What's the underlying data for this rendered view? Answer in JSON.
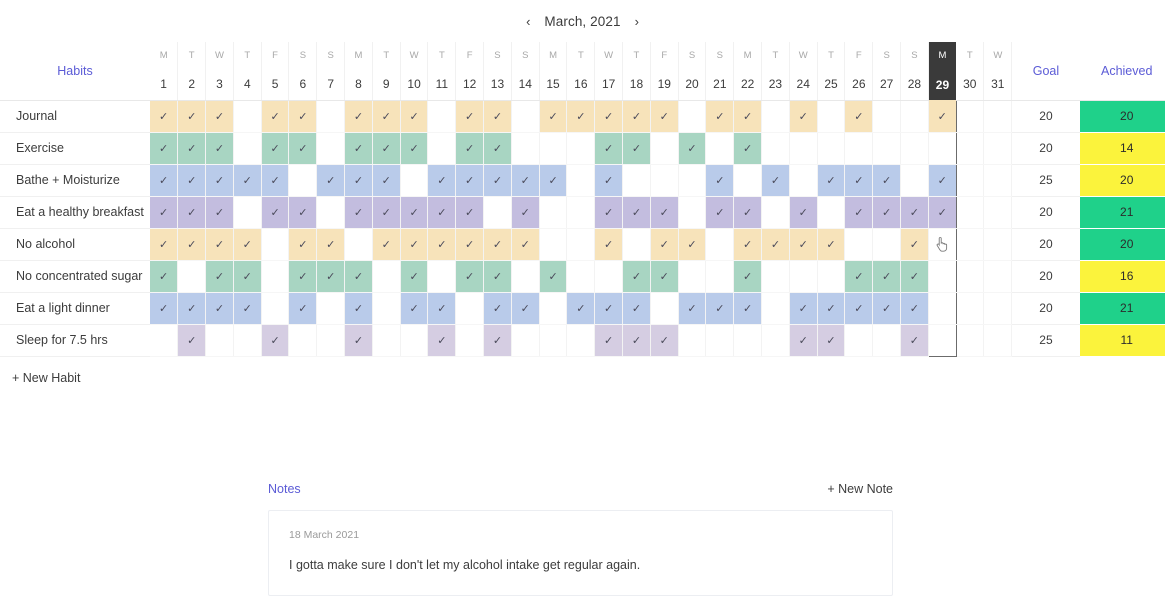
{
  "month_nav": {
    "prev_icon": "chevron-left-icon",
    "prev_label": "‹",
    "label": "March, 2021",
    "next_icon": "chevron-right-icon",
    "next_label": "›"
  },
  "tracker": {
    "habits_header": "Habits",
    "goal_header": "Goal",
    "achieved_header": "Achieved",
    "new_habit_label": "+ New Habit",
    "today": 29,
    "days": [
      1,
      2,
      3,
      4,
      5,
      6,
      7,
      8,
      9,
      10,
      11,
      12,
      13,
      14,
      15,
      16,
      17,
      18,
      19,
      20,
      21,
      22,
      23,
      24,
      25,
      26,
      27,
      28,
      29,
      30,
      31
    ],
    "dow": [
      "M",
      "T",
      "W",
      "T",
      "F",
      "S",
      "S",
      "M",
      "T",
      "W",
      "T",
      "F",
      "S",
      "S",
      "M",
      "T",
      "W",
      "T",
      "F",
      "S",
      "S",
      "M",
      "T",
      "W",
      "T",
      "F",
      "S",
      "S",
      "M",
      "T",
      "W"
    ],
    "check_glyph": "✓",
    "colors": {
      "peach": "#f7e3ba",
      "green": "#a8d5c2",
      "blue": "#b9cbea",
      "purple": "#c3bddf",
      "lilac": "#d5cde2",
      "achieved_met": "#1fd18a",
      "achieved_miss": "#fbf33c",
      "today_header_bg": "#3a3a3a",
      "accent": "#5b5bd6"
    },
    "rows": [
      {
        "name": "Journal",
        "color": "peach",
        "goal": 20,
        "achieved": 20,
        "met": true,
        "checks": [
          1,
          2,
          3,
          5,
          6,
          8,
          9,
          10,
          12,
          13,
          15,
          16,
          17,
          18,
          19,
          21,
          22,
          24,
          26,
          29
        ]
      },
      {
        "name": "Exercise",
        "color": "green",
        "goal": 20,
        "achieved": 14,
        "met": false,
        "checks": [
          1,
          2,
          3,
          5,
          6,
          8,
          9,
          10,
          12,
          13,
          17,
          18,
          20,
          22
        ]
      },
      {
        "name": "Bathe + Moisturize",
        "color": "blue",
        "goal": 25,
        "achieved": 20,
        "met": false,
        "checks": [
          1,
          2,
          3,
          4,
          5,
          7,
          8,
          9,
          11,
          12,
          13,
          14,
          15,
          17,
          21,
          23,
          25,
          26,
          27,
          29
        ]
      },
      {
        "name": "Eat a healthy breakfast",
        "color": "purple",
        "goal": 20,
        "achieved": 21,
        "met": true,
        "checks": [
          1,
          2,
          3,
          5,
          6,
          8,
          9,
          10,
          11,
          12,
          14,
          17,
          18,
          19,
          21,
          22,
          24,
          26,
          27,
          28,
          29
        ]
      },
      {
        "name": "No alcohol",
        "color": "peach",
        "goal": 20,
        "achieved": 20,
        "met": true,
        "checks": [
          1,
          2,
          3,
          4,
          6,
          7,
          9,
          10,
          11,
          12,
          13,
          14,
          17,
          19,
          20,
          22,
          23,
          24,
          25,
          28
        ]
      },
      {
        "name": "No concentrated sugar",
        "color": "green",
        "goal": 20,
        "achieved": 16,
        "met": false,
        "checks": [
          1,
          3,
          4,
          6,
          7,
          8,
          10,
          12,
          13,
          15,
          18,
          19,
          22,
          26,
          27,
          28
        ]
      },
      {
        "name": "Eat a light dinner",
        "color": "blue",
        "goal": 20,
        "achieved": 21,
        "met": true,
        "checks": [
          1,
          2,
          3,
          4,
          6,
          8,
          10,
          11,
          13,
          14,
          16,
          17,
          18,
          20,
          21,
          22,
          24,
          25,
          26,
          27,
          28
        ]
      },
      {
        "name": "Sleep for 7.5 hrs",
        "color": "lilac",
        "goal": 25,
        "achieved": 11,
        "met": false,
        "checks": [
          2,
          5,
          8,
          11,
          13,
          17,
          18,
          19,
          24,
          25,
          28
        ]
      }
    ]
  },
  "notes": {
    "title": "Notes",
    "new_note_label": "+ New Note",
    "entries": [
      {
        "date": "18 March 2021",
        "text": "I gotta make sure I don't let my alcohol intake get regular again."
      }
    ]
  }
}
